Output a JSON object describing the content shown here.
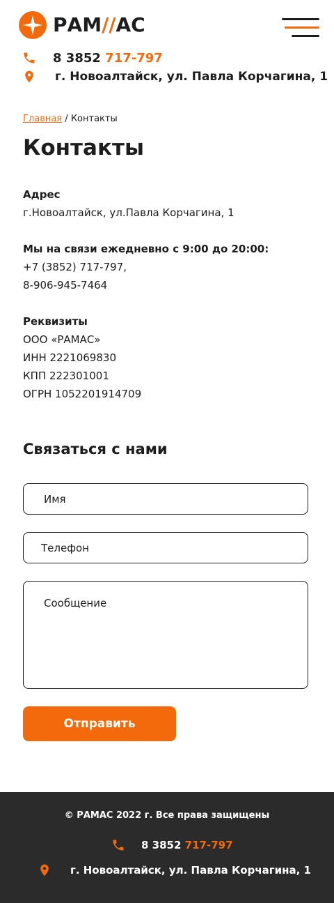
{
  "brand": {
    "logo_text_left": "РАМ",
    "logo_text_right": "АС",
    "accent_color": "#f26a0c",
    "dark_color": "#1d1d1d",
    "footer_bg": "#2b2b2b"
  },
  "header": {
    "phone_prefix": "8 3852",
    "phone_highlight": "717-797",
    "address": "г. Новоалтайск, ул. Павла Корчагина, 1",
    "menu_icon": "burger-menu-icon"
  },
  "breadcrumb": {
    "home": "Главная",
    "separator": " / ",
    "current": "Контакты"
  },
  "page": {
    "title": "Контакты"
  },
  "contacts": {
    "address_heading": "Адрес",
    "address_value": "г.Новоалтайск, ул.Павла Корчагина, 1",
    "hours_heading": "Мы на связи ежедневно с 9:00 до 20:00:",
    "phone_1": "+7 (3852) 717-797,",
    "phone_2": "8-906-945-7464",
    "requisites_heading": "Реквизиты",
    "company": "ООО «РАМАС»",
    "inn": "ИНН 2221069830",
    "kpp": "КПП 222301001",
    "ogrn": "ОГРН 1052201914709"
  },
  "form": {
    "title": "Связаться с нами",
    "name_placeholder": "Имя",
    "phone_placeholder": "Телефон",
    "message_placeholder": "Сообщение",
    "submit_label": "Отправить"
  },
  "footer": {
    "copyright": "© РАМАС 2022 г. Все права защищены",
    "phone_prefix": "8 3852",
    "phone_highlight": "717-797",
    "address": "г. Новоалтайск, ул. Павла Корчагина, 1"
  }
}
